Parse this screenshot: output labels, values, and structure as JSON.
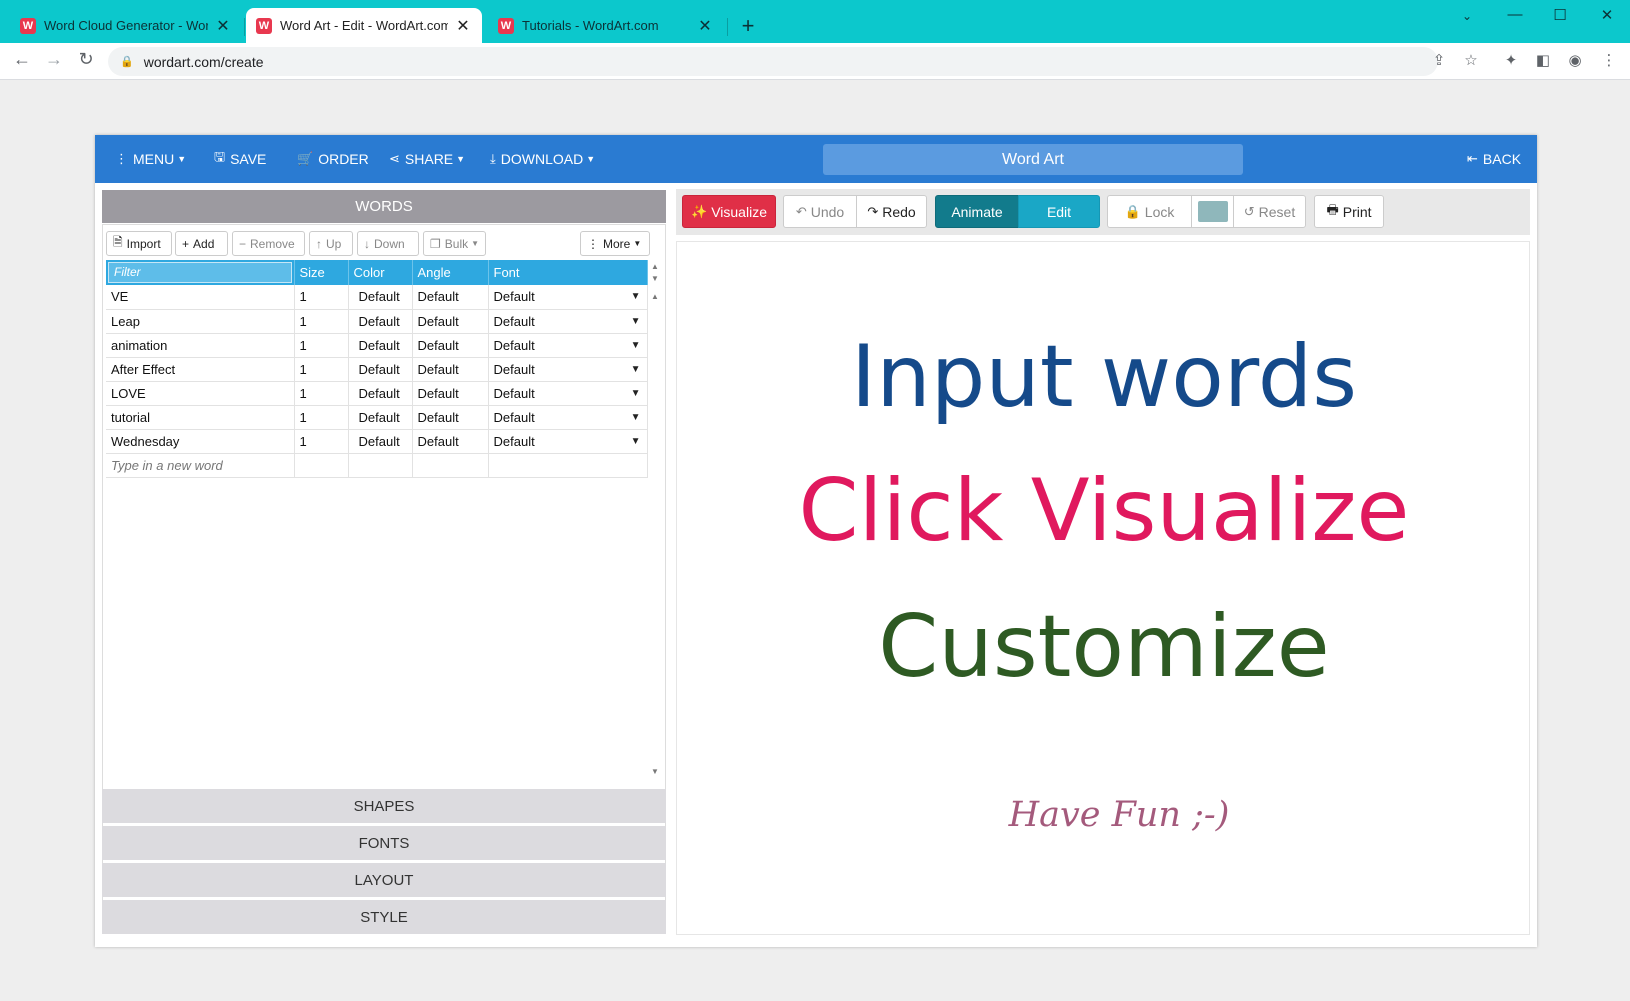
{
  "browser": {
    "tabs": [
      {
        "title": "Word Cloud Generator - WordArt.com",
        "favicon": "W"
      },
      {
        "title": "Word Art - Edit - WordArt.com",
        "favicon": "W"
      },
      {
        "title": "Tutorials - WordArt.com",
        "favicon": "W"
      }
    ],
    "active_tab": 1,
    "new_tab": "+",
    "url": "wordart.com/create",
    "colors": {
      "tabbar": "#0cc8cc"
    }
  },
  "topbar": {
    "menu": "MENU",
    "save": "SAVE",
    "order": "ORDER",
    "share": "SHARE",
    "download": "DOWNLOAD",
    "title": "Word Art",
    "back": "BACK",
    "colors": {
      "bar": "#2a7bd2"
    }
  },
  "words_panel": {
    "header": "WORDS",
    "toolbar": {
      "import": "Import",
      "add": "Add",
      "remove": "Remove",
      "up": "Up",
      "down": "Down",
      "bulk": "Bulk",
      "more": "More"
    },
    "filter_placeholder": "Filter",
    "columns": {
      "size": "Size",
      "color": "Color",
      "angle": "Angle",
      "font": "Font"
    },
    "rows": [
      {
        "word": "VE",
        "size": "1",
        "color": "Default",
        "angle": "Default",
        "font": "Default"
      },
      {
        "word": "Leap",
        "size": "1",
        "color": "Default",
        "angle": "Default",
        "font": "Default"
      },
      {
        "word": "animation",
        "size": "1",
        "color": "Default",
        "angle": "Default",
        "font": "Default"
      },
      {
        "word": "After Effect",
        "size": "1",
        "color": "Default",
        "angle": "Default",
        "font": "Default"
      },
      {
        "word": "LOVE",
        "size": "1",
        "color": "Default",
        "angle": "Default",
        "font": "Default"
      },
      {
        "word": "tutorial",
        "size": "1",
        "color": "Default",
        "angle": "Default",
        "font": "Default"
      },
      {
        "word": "Wednesday",
        "size": "1",
        "color": "Default",
        "angle": "Default",
        "font": "Default"
      }
    ],
    "new_word_placeholder": "Type in a new word"
  },
  "sections": {
    "shapes": "SHAPES",
    "fonts": "FONTS",
    "layout": "LAYOUT",
    "style": "STYLE"
  },
  "canvas_toolbar": {
    "visualize": "Visualize",
    "undo": "Undo",
    "redo": "Redo",
    "animate": "Animate",
    "edit": "Edit",
    "lock": "Lock",
    "swatch_color": "#8fb7bb",
    "reset": "Reset",
    "print": "Print"
  },
  "canvas": {
    "line1": "Input words",
    "line2": "Click Visualize",
    "line3": "Customize",
    "line4": "Have Fun ;-)",
    "colors": {
      "line1": "#154a8a",
      "line2": "#e0195e",
      "line3": "#2e5a23",
      "line4": "#a45a7c"
    }
  }
}
